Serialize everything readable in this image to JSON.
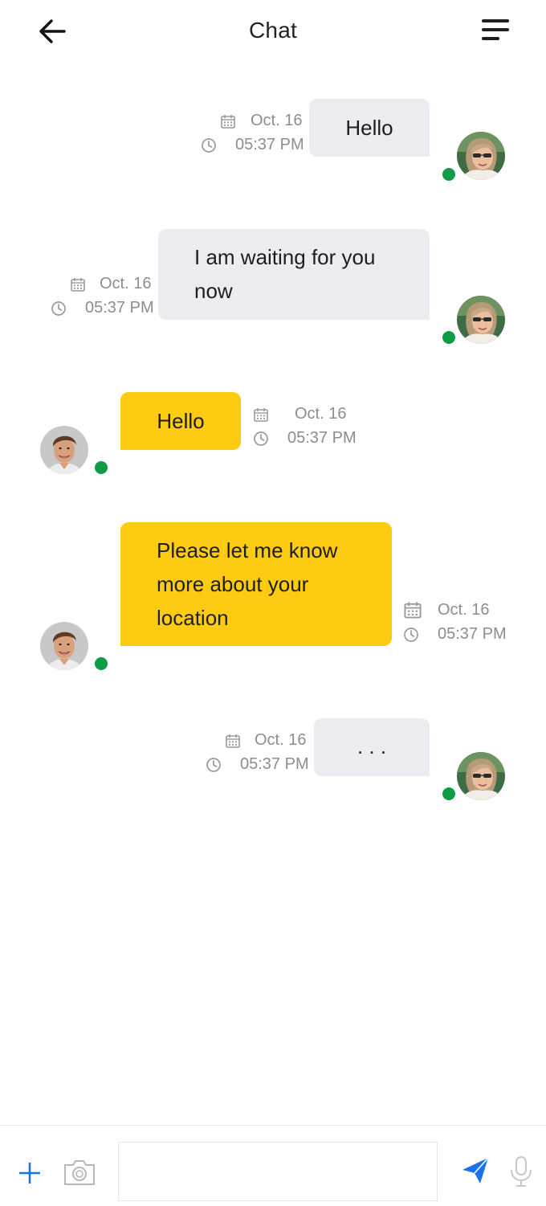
{
  "header": {
    "title": "Chat",
    "back_icon": "arrow-left-icon",
    "menu_icon": "menu-icon"
  },
  "messages": [
    {
      "side": "incoming",
      "text": "Hello",
      "date": "Oct. 16",
      "time": "05:37 PM",
      "avatar": "woman-avatar",
      "online": true
    },
    {
      "side": "incoming",
      "text": "I am waiting for you now",
      "date": "Oct. 16",
      "time": "05:37 PM",
      "avatar": "woman-avatar",
      "online": true
    },
    {
      "side": "outgoing",
      "text": "Hello",
      "date": "Oct. 16",
      "time": "05:37 PM",
      "avatar": "man-avatar",
      "online": true
    },
    {
      "side": "outgoing",
      "text": "Please let me know more about your location",
      "date": "Oct. 16",
      "time": "05:37 PM",
      "avatar": "man-avatar",
      "online": true
    },
    {
      "side": "incoming",
      "text": ". . .",
      "date": "Oct. 16",
      "time": "05:37 PM",
      "avatar": "woman-avatar",
      "online": true
    }
  ],
  "composer": {
    "plus_icon": "plus-icon",
    "camera_icon": "camera-icon",
    "input_value": "",
    "send_icon": "send-icon",
    "mic_icon": "microphone-icon"
  },
  "colors": {
    "incoming_bubble": "#ececf0",
    "outgoing_bubble": "#fdcc12",
    "online_dot": "#109b48",
    "accent_blue": "#1a73e8",
    "meta_text": "#8d8d8d"
  }
}
